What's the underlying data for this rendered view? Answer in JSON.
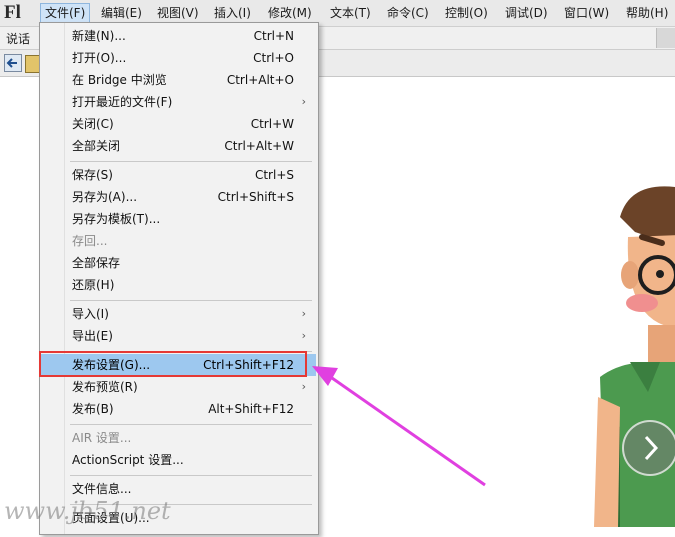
{
  "app": {
    "logo_text": "Fl"
  },
  "menubar": {
    "items": [
      {
        "label": "文件(F)"
      },
      {
        "label": "编辑(E)"
      },
      {
        "label": "视图(V)"
      },
      {
        "label": "插入(I)"
      },
      {
        "label": "修改(M)"
      },
      {
        "label": "文本(T)"
      },
      {
        "label": "命令(C)"
      },
      {
        "label": "控制(O)"
      },
      {
        "label": "调试(D)"
      },
      {
        "label": "窗口(W)"
      },
      {
        "label": "帮助(H)"
      }
    ]
  },
  "document_tab": {
    "label": "说话"
  },
  "file_menu": {
    "items": [
      {
        "label": "新建(N)...",
        "shortcut": "Ctrl+N"
      },
      {
        "label": "打开(O)...",
        "shortcut": "Ctrl+O"
      },
      {
        "label": "在 Bridge 中浏览",
        "shortcut": "Ctrl+Alt+O"
      },
      {
        "label": "打开最近的文件(F)",
        "shortcut": "",
        "submenu": true
      },
      {
        "label": "关闭(C)",
        "shortcut": "Ctrl+W"
      },
      {
        "label": "全部关闭",
        "shortcut": "Ctrl+Alt+W"
      },
      {
        "label": "保存(S)",
        "shortcut": "Ctrl+S"
      },
      {
        "label": "另存为(A)...",
        "shortcut": "Ctrl+Shift+S"
      },
      {
        "label": "另存为模板(T)...",
        "shortcut": ""
      },
      {
        "label": "存回...",
        "shortcut": "",
        "disabled": true
      },
      {
        "label": "全部保存",
        "shortcut": ""
      },
      {
        "label": "还原(H)",
        "shortcut": ""
      },
      {
        "label": "导入(I)",
        "shortcut": "",
        "submenu": true
      },
      {
        "label": "导出(E)",
        "shortcut": "",
        "submenu": true
      },
      {
        "label": "发布设置(G)...",
        "shortcut": "Ctrl+Shift+F12",
        "highlighted": true
      },
      {
        "label": "发布预览(R)",
        "shortcut": "",
        "submenu": true
      },
      {
        "label": "发布(B)",
        "shortcut": "Alt+Shift+F12"
      },
      {
        "label": "AIR 设置...",
        "shortcut": "",
        "disabled": true
      },
      {
        "label": "ActionScript 设置...",
        "shortcut": ""
      },
      {
        "label": "文件信息...",
        "shortcut": ""
      },
      {
        "label": "页面设置(U)...",
        "shortcut": ""
      }
    ]
  },
  "icons": {
    "back": "back-arrow-icon",
    "scene": "scene-icon",
    "submenu": "chevron-right-icon",
    "next": "chevron-right-circle-icon"
  },
  "colors": {
    "highlight": "#9dc8ef",
    "callout": "#e53935",
    "arrow": "#e040e0"
  },
  "watermark": {
    "text": "www.jb51.net"
  }
}
